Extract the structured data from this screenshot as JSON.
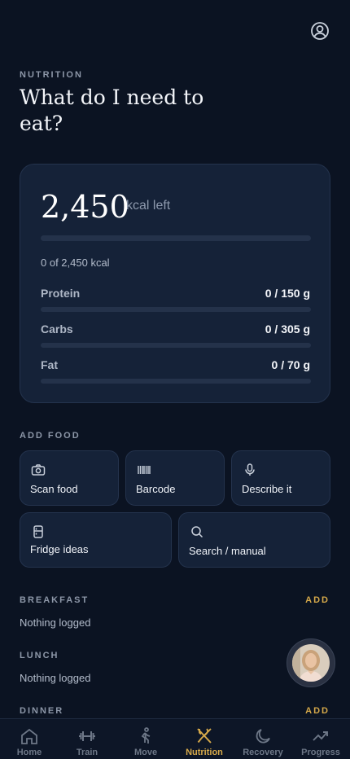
{
  "header": {
    "eyebrow": "NUTRITION",
    "title": "What do I need to eat?"
  },
  "summary": {
    "kcal_remaining": "2,450",
    "kcal_left_label": "kcal left",
    "kcal_progress": 0,
    "kcal_count_text": "0 of 2,450 kcal",
    "macros": [
      {
        "label": "Protein",
        "value": "0 / 150 g",
        "progress": 0
      },
      {
        "label": "Carbs",
        "value": "0 / 305 g",
        "progress": 0
      },
      {
        "label": "Fat",
        "value": "0 / 70 g",
        "progress": 0
      }
    ]
  },
  "add_food": {
    "label": "ADD FOOD",
    "options": [
      {
        "label": "Scan food",
        "icon": "camera-icon"
      },
      {
        "label": "Barcode",
        "icon": "barcode-icon"
      },
      {
        "label": "Describe it",
        "icon": "microphone-icon"
      },
      {
        "label": "Fridge ideas",
        "icon": "fridge-icon"
      },
      {
        "label": "Search / manual",
        "icon": "search-icon"
      }
    ]
  },
  "meals": [
    {
      "label": "BREAKFAST",
      "add_label": "ADD",
      "empty_text": "Nothing logged"
    },
    {
      "label": "LUNCH",
      "add_label": "",
      "empty_text": "Nothing logged"
    },
    {
      "label": "DINNER",
      "add_label": "ADD",
      "empty_text": ""
    }
  ],
  "tabs": [
    {
      "label": "Home",
      "icon": "home-icon",
      "active": false
    },
    {
      "label": "Train",
      "icon": "dumbbell-icon",
      "active": false
    },
    {
      "label": "Move",
      "icon": "walking-icon",
      "active": false
    },
    {
      "label": "Nutrition",
      "icon": "fork-knife-icon",
      "active": true
    },
    {
      "label": "Recovery",
      "icon": "moon-icon",
      "active": false
    },
    {
      "label": "Progress",
      "icon": "trend-icon",
      "active": false
    }
  ],
  "colors": {
    "background": "#0b1322",
    "card": "#152238",
    "accent": "#d6a94a",
    "muted_text": "#8d97a8"
  }
}
